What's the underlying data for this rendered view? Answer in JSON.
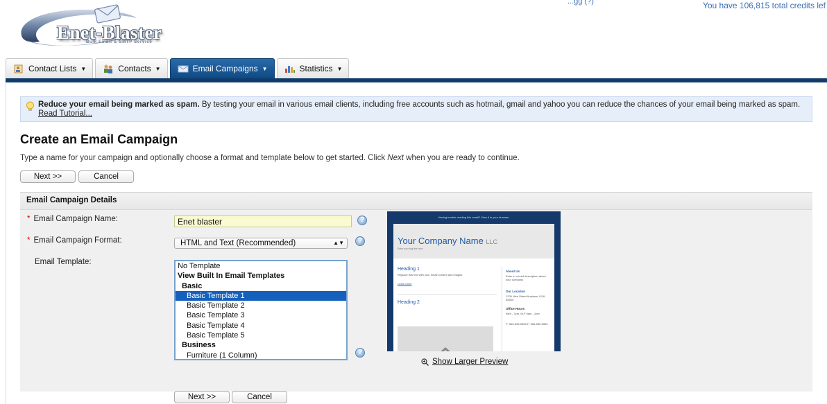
{
  "header": {
    "logo_text": "Enet-Blaster",
    "logo_subtext": "Bulk Email & SMTP Service",
    "top_cut_text": "...gg                (?)",
    "credits_text": "You have 106,815 total credits lef"
  },
  "tabs": [
    {
      "label": "Contact Lists",
      "icon": "contact-lists-icon",
      "active": false
    },
    {
      "label": "Contacts",
      "icon": "contacts-icon",
      "active": false
    },
    {
      "label": "Email Campaigns",
      "icon": "envelope-icon",
      "active": true
    },
    {
      "label": "Statistics",
      "icon": "bar-chart-icon",
      "active": false
    }
  ],
  "tip": {
    "bold": "Reduce your email being marked as spam.",
    "text": " By testing your email in various email clients, including free accounts such as hotmail, gmail and yahoo you can reduce the chances of your email being marked as spam.",
    "link": "Read Tutorial..."
  },
  "page": {
    "title": "Create an Email Campaign",
    "intro_before": "Type a name for your campaign and optionally choose a format and template below to get started. Click ",
    "intro_em": "Next",
    "intro_after": " when you are ready to continue."
  },
  "buttons": {
    "next": "Next >>",
    "cancel": "Cancel"
  },
  "details": {
    "header": "Email Campaign Details",
    "name_label": "Email Campaign Name:",
    "name_value": "Enet blaster",
    "format_label": "Email Campaign Format:",
    "format_value": "HTML and Text (Recommended)",
    "template_label": "Email Template:",
    "template_options": [
      {
        "label": "No Template",
        "kind": "opt"
      },
      {
        "label": "View Built In Email Templates",
        "kind": "grp"
      },
      {
        "label": "Basic",
        "kind": "grp2"
      },
      {
        "label": "Basic Template 1",
        "kind": "sub",
        "selected": true
      },
      {
        "label": "Basic Template 2",
        "kind": "sub"
      },
      {
        "label": "Basic Template 3",
        "kind": "sub"
      },
      {
        "label": "Basic Template 4",
        "kind": "sub"
      },
      {
        "label": "Basic Template 5",
        "kind": "sub"
      },
      {
        "label": "Business",
        "kind": "grp2"
      },
      {
        "label": "Furniture (1 Column)",
        "kind": "sub"
      }
    ],
    "show_larger": "Show Larger Preview"
  },
  "preview": {
    "top_text": "Having trouble reading this email? View it in your browser.",
    "company": "Your Company Name",
    "company_suffix": "LLC",
    "tagline": "Enter your tag line here",
    "heading1": "Heading 1",
    "heading1_text": "Replace this text with your email content and images",
    "learn_more": "Learn more",
    "heading2": "Heading 2",
    "about_title": "About Us",
    "about_text": "Enter in a brief description about your company",
    "location_title": "Our Location",
    "location_text": "1234 Nice Street Anytown, USA 55555",
    "hours_title": "Office Hours",
    "hours_text": "9am - 7pm, M-F 9am - 1pm",
    "phone_text": "P: 555-555-5555 F: 555-555-5555"
  },
  "colors": {
    "nav_active": "#0d4a86",
    "accent_bar": "#0f3c6a",
    "link_blue": "#3b6fb4",
    "selection": "#1560bd"
  }
}
